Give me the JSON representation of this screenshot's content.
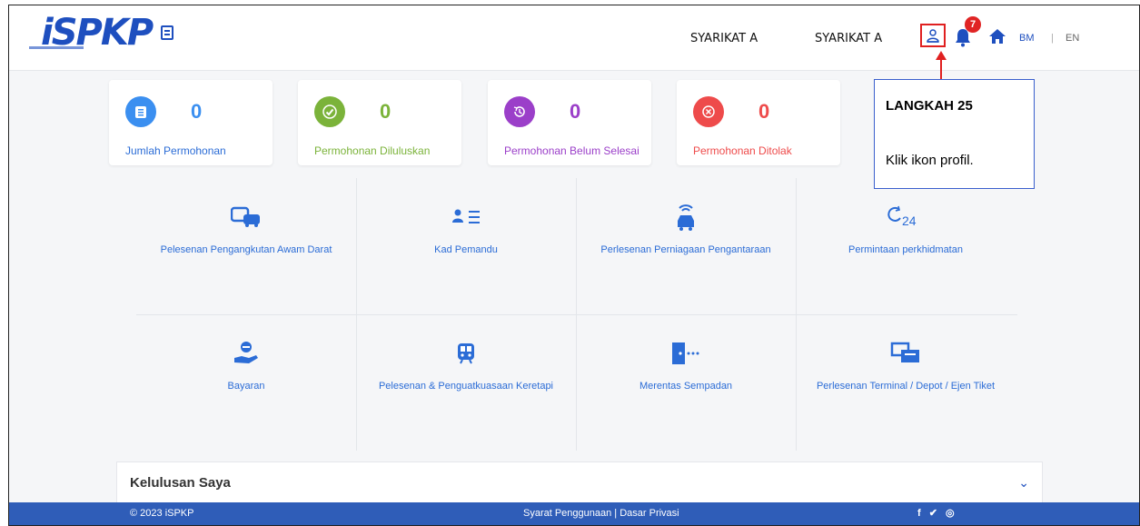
{
  "header": {
    "logo_text": "iSPKP",
    "company_1": "SYARIKAT A",
    "company_2": "SYARIKAT A",
    "notification_count": "7",
    "lang_bm": "BM",
    "lang_separator": "|",
    "lang_en": "EN"
  },
  "stats": [
    {
      "value": "0",
      "label": "Jumlah Permohonan",
      "color": "#3b8ff0",
      "icon": "clipboard-icon"
    },
    {
      "value": "0",
      "label": "Permohonan Diluluskan",
      "color": "#7bb33a",
      "icon": "check-icon"
    },
    {
      "value": "0",
      "label": "Permohonan Belum Selesai",
      "color": "#9b3fc9",
      "icon": "history-icon"
    },
    {
      "value": "0",
      "label": "Permohonan Ditolak",
      "color": "#ee4b4b",
      "icon": "cancel-icon"
    }
  ],
  "services": [
    {
      "label": "Pelesenan Pengangkutan Awam Darat",
      "icon": "vehicles-icon"
    },
    {
      "label": "Kad Pemandu",
      "icon": "driver-card-icon"
    },
    {
      "label": "Perlesenan Perniagaan Pengantaraan",
      "icon": "connected-car-icon"
    },
    {
      "label": "Permintaan perkhidmatan",
      "icon": "service-24-icon"
    },
    {
      "label": "Bayaran",
      "icon": "payment-hand-icon"
    },
    {
      "label": "Pelesenan & Penguatkuasaan Keretapi",
      "icon": "train-icon"
    },
    {
      "label": "Merentas Sempadan",
      "icon": "border-crossing-icon"
    },
    {
      "label": "Perlesenan Terminal / Depot / Ejen Tiket",
      "icon": "terminal-icon"
    }
  ],
  "callout": {
    "title": "LANGKAH 25",
    "body": "Klik ikon profil."
  },
  "approvals": {
    "title": "Kelulusan Saya"
  },
  "footer": {
    "copyright": "© 2023 iSPKP",
    "links": "Syarat Penggunaan | Dasar Privasi",
    "social": "f ✔ ◎"
  },
  "colors": {
    "brand": "#1e4fbf",
    "link": "#2b6cd6",
    "footer": "#2f5db8",
    "annotation_red": "#e02020"
  }
}
